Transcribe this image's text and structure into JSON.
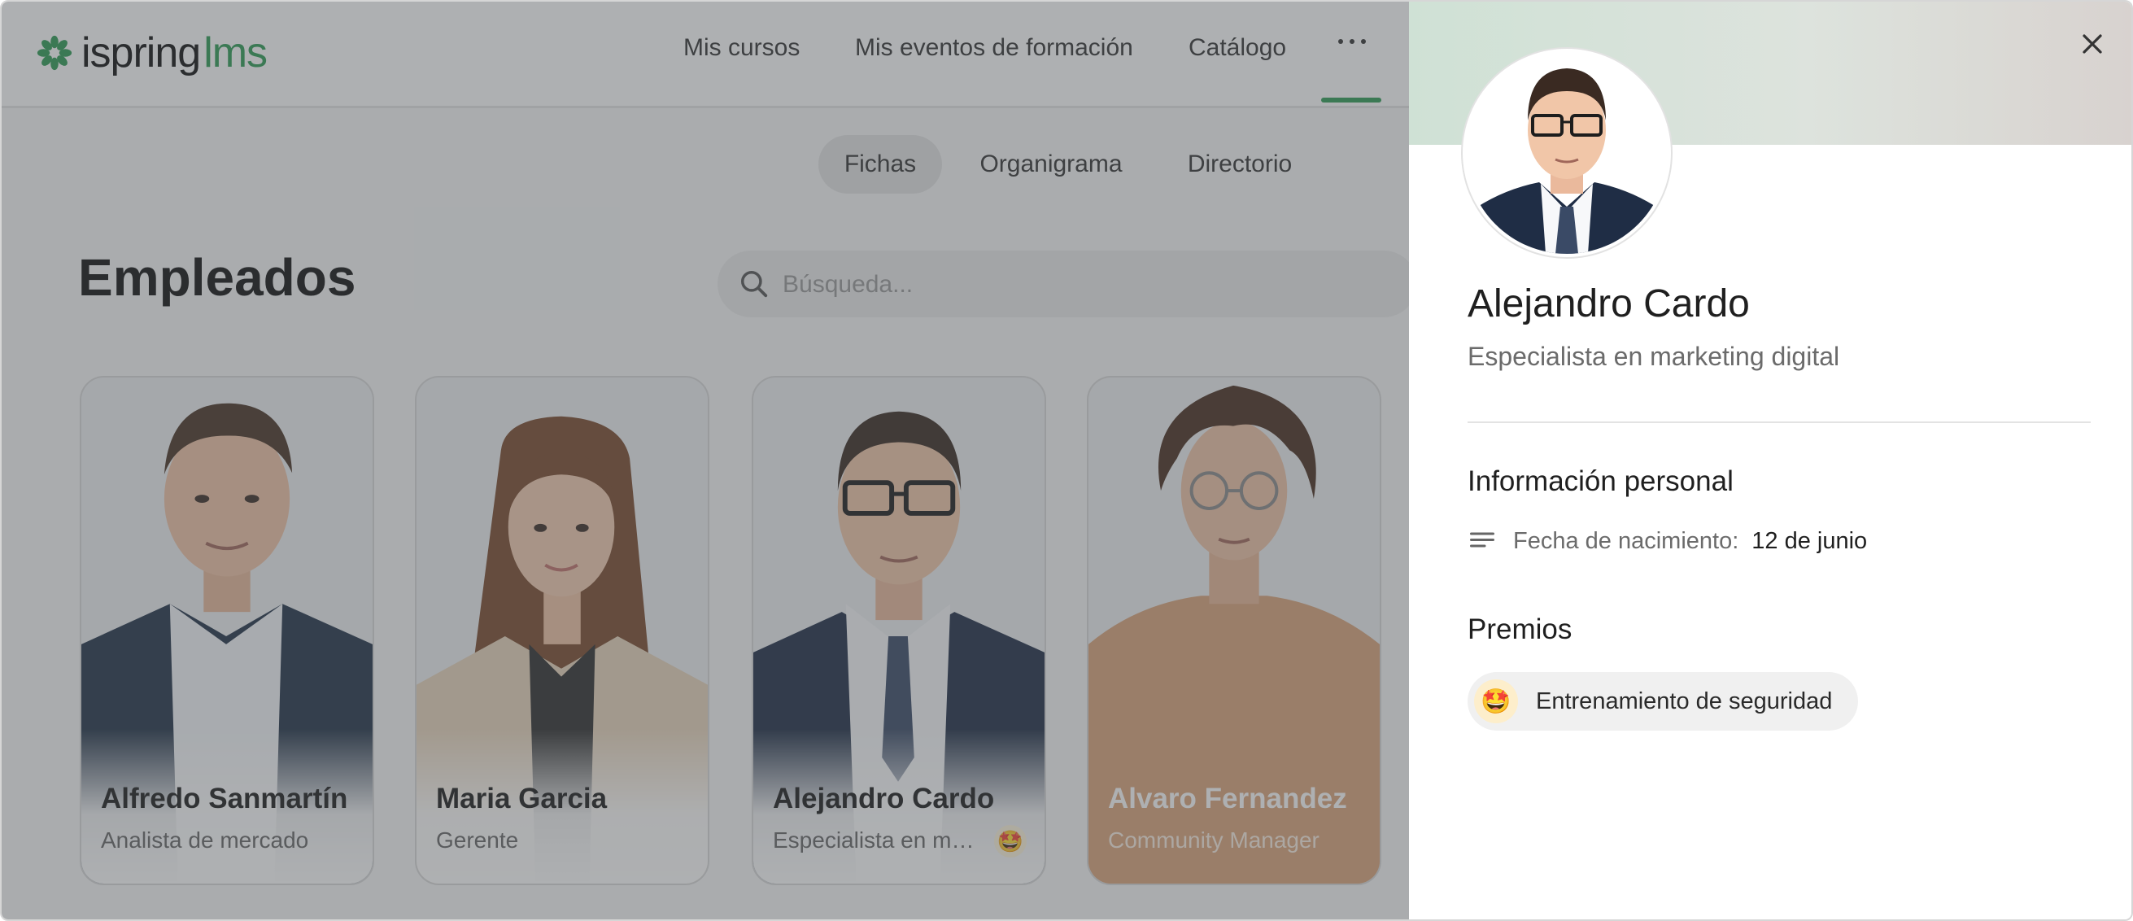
{
  "brand": {
    "name_part1": "ispring",
    "name_part2": "lms",
    "accent": "#2e9c55"
  },
  "nav": {
    "items": [
      {
        "label": "Mis cursos"
      },
      {
        "label": "Mis eventos de formación"
      },
      {
        "label": "Catálogo"
      }
    ],
    "more_icon": "more-horizontal-icon",
    "active": "more"
  },
  "subtabs": [
    {
      "label": "Fichas",
      "active": true
    },
    {
      "label": "Organigrama",
      "active": false
    },
    {
      "label": "Directorio",
      "active": false
    }
  ],
  "page": {
    "title": "Empleados"
  },
  "search": {
    "placeholder": "Búsqueda...",
    "icon": "search-icon"
  },
  "employees": [
    {
      "name": "Alfredo Sanmartín",
      "role": "Analista de mercado",
      "badge": false
    },
    {
      "name": "Maria Garcia",
      "role": "Gerente",
      "badge": false
    },
    {
      "name": "Alejandro Cardo",
      "role": "Especialista en marketing digital",
      "badge": true
    },
    {
      "name": "Alvaro Fernandez",
      "role": "Community Manager",
      "badge": false
    }
  ],
  "profile": {
    "name": "Alejandro Cardo",
    "role": "Especialista en marketing digital",
    "personal_title": "Información personal",
    "birth_label": "Fecha de nacimiento:",
    "birth_value": "12 de junio",
    "awards_title": "Premios",
    "award": {
      "label": "Entrenamiento de seguridad",
      "icon": "star-struck-emoji-icon"
    },
    "close_icon": "close-icon"
  }
}
